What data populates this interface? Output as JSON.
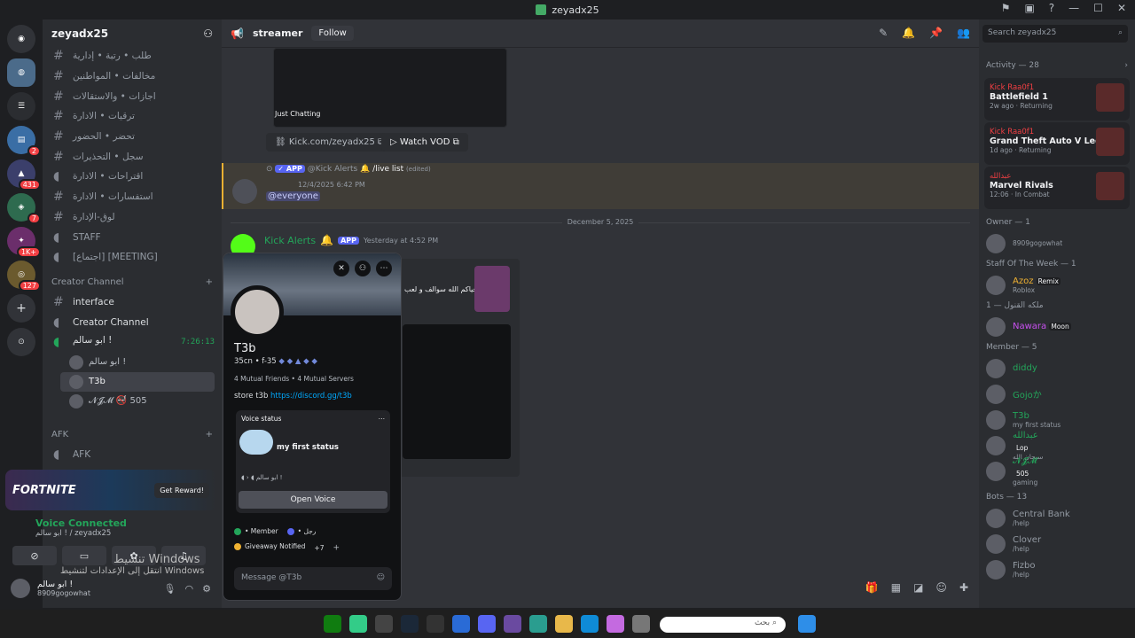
{
  "window": {
    "title": "zeyadx25"
  },
  "server": {
    "name": "zeyadx25",
    "channels": [
      {
        "label": "طلب • رتبة • إدارية",
        "icon": "hash"
      },
      {
        "label": "مخالفات • المواطنين",
        "icon": "hash"
      },
      {
        "label": "اجازات • والاستقالات",
        "icon": "hash"
      },
      {
        "label": "ترقيات • الادارة",
        "icon": "hash"
      },
      {
        "label": "تحضر • الحضور",
        "icon": "hash"
      },
      {
        "label": "سجل • التحذيرات",
        "icon": "hash"
      },
      {
        "label": "اقتراحات • الادارة",
        "icon": "speaker"
      },
      {
        "label": "استفسارات • الادارة",
        "icon": "hash"
      },
      {
        "label": "لوق-الإدارة",
        "icon": "hash"
      },
      {
        "label": "STAFF",
        "icon": "speaker"
      },
      {
        "label": "[اجتماع] [MEETING]",
        "icon": "speaker"
      }
    ],
    "creator_category": "Creator Channel",
    "creator_channels": [
      "interface",
      "Creator Channel"
    ],
    "voice_channel": {
      "name": "ابو سالم !",
      "timer": "7:26:13",
      "users": [
        {
          "name": "ابو سالم !",
          "selected": false
        },
        {
          "name": "T3b",
          "selected": true
        },
        {
          "name": "𝓝𝓙𝓜 🚭 505",
          "selected": false
        }
      ]
    },
    "afk_category": "AFK",
    "afk_channel": "AFK"
  },
  "promo": {
    "brand": "FORTNITE",
    "cta": "Get Reward!"
  },
  "voice_bar": {
    "status": "Voice Connected",
    "location": "ابو سالم ! / zeyadx25"
  },
  "user_panel": {
    "name": "ابو سالم !",
    "status": "8909gogowhat"
  },
  "chat": {
    "channel_name": "streamer",
    "follow_label": "Follow",
    "embed_caption": "Just Chatting",
    "link_label": "Kick.com/zeyadx25",
    "vod_label": "Watch VOD",
    "mention_msg": {
      "author": "@Kick Alerts",
      "command": "/live list",
      "edited": "(edited)",
      "time": "12/4/2025 6:42 PM",
      "content": "@everyone"
    },
    "date_divider": "December 5, 2025",
    "alert_msg": {
      "author": "Kick Alerts",
      "time": "Yesterday at 4:52 PM",
      "tag": "APP"
    },
    "embed_arabic": "حياكم الله سوالف و لعب"
  },
  "profile": {
    "name": "T3b",
    "tag": "35cn • f-35",
    "mutual_friends": "4 Mutual Friends",
    "mutual_servers": "4 Mutual Servers",
    "bio_text": "store t3b",
    "bio_link": "https://discord.gg/t3b",
    "voice_status_label": "Voice status",
    "status_text": "my first status",
    "voice_channel": "ابو سالم !",
    "open_voice": "Open Voice",
    "roles": [
      {
        "name": "• Member",
        "color": "#23a55a"
      },
      {
        "name": "• رجل",
        "color": "#5865f2"
      },
      {
        "name": "Giveaway Notified",
        "color": "#f0b232"
      },
      {
        "name": "+7",
        "color": ""
      }
    ],
    "message_placeholder": "Message @T3b"
  },
  "members": {
    "search_placeholder": "Search zeyadx25",
    "activity_header": "Activity — 28",
    "activities": [
      {
        "user": "Kick Raa0f1",
        "game": "Battlefield 1",
        "meta": "2w ago · Returning"
      },
      {
        "user": "Kick Raa0f1",
        "game": "Grand Theft Auto V Legacy",
        "meta": "1d ago · Returning"
      },
      {
        "user": "عبدالله",
        "game": "Marvel Rivals",
        "meta": "12:06 · In Combat"
      }
    ],
    "owner_header": "Owner — 1",
    "owner": {
      "name": "",
      "sub": "8909gogowhat"
    },
    "staff_header": "Staff Of The Week — 1",
    "staff": {
      "name": "Azoz",
      "tag": "Remix",
      "sub": "Roblox"
    },
    "queen_header": "ملكه القنول — 1",
    "queen": {
      "name": "Nawara",
      "tag": "Moon"
    },
    "member_header": "Member — 5",
    "member_list": [
      {
        "name": "diddy",
        "sub": ""
      },
      {
        "name": "Gojoか",
        "sub": ""
      },
      {
        "name": "T3b",
        "sub": "my first status"
      },
      {
        "name": "عبدالله",
        "sub": "سبحان الله",
        "tag": "Lop"
      },
      {
        "name": "𝓝𝓙𝓜",
        "sub": "gaming",
        "tag": "505"
      }
    ],
    "bots_header": "Bots — 13",
    "bots": [
      {
        "name": "Central Bank",
        "sub": "/help"
      },
      {
        "name": "Clover",
        "sub": "/help"
      },
      {
        "name": "Fizbo",
        "sub": "/help"
      }
    ]
  },
  "taskbar": {
    "search_placeholder": "بحث"
  },
  "watermark": {
    "line1": "تنشيط Windows",
    "line2": "انتقل إلى الإعدادات لتنشيط Windows"
  }
}
